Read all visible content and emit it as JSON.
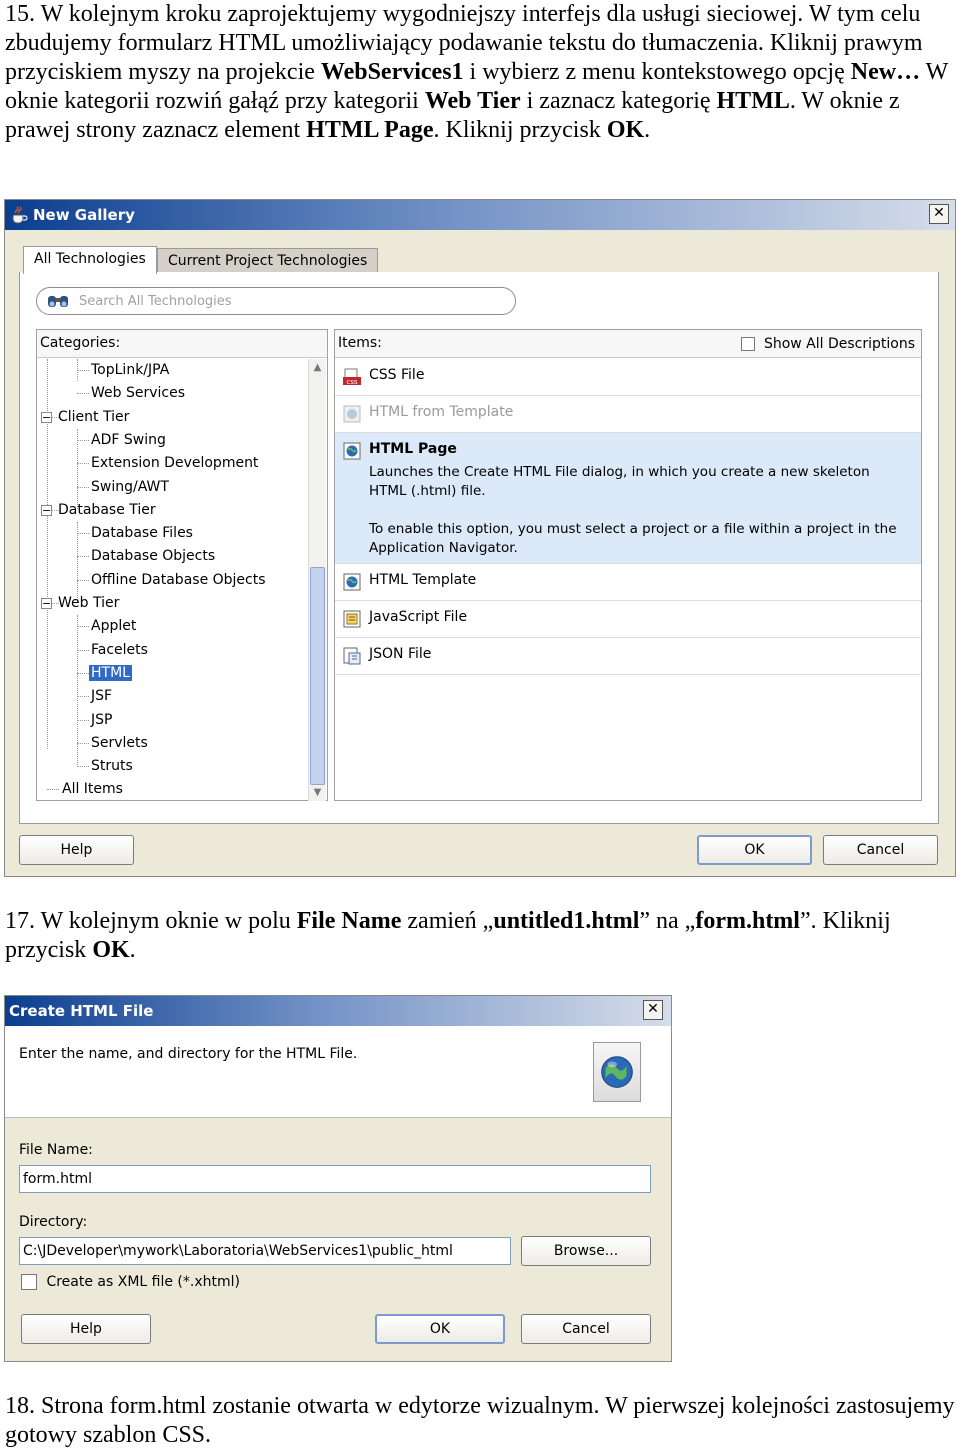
{
  "instructions": {
    "step15": {
      "t1": "15. W kolejnym kroku zaprojektujemy wygodniejszy interfejs dla usługi sieciowej. W tym celu zbudujemy formularz HTML umożliwiający podawanie tekstu do tłumaczenia. Kliknij prawym przyciskiem myszy na projekcie ",
      "b1": "WebServices1",
      "t2": " i wybierz z menu kontekstowego opcję ",
      "b2": "New…",
      "t3": " W oknie kategorii rozwiń gałąź przy kategorii ",
      "b3": "Web Tier",
      "t4": " i zaznacz kategorię ",
      "b4": "HTML",
      "t5": ". W oknie z prawej strony zaznacz element ",
      "b5": "HTML Page",
      "t6": ". Kliknij przycisk ",
      "b6": "OK",
      "t7": "."
    },
    "step17": {
      "t1": "17. W kolejnym oknie w polu ",
      "b1": "File Name",
      "t2": " zamień „",
      "b2": "untitled1.html",
      "t3": "” na „",
      "b3": "form.html",
      "t4": "”. Kliknij przycisk ",
      "b4": "OK",
      "t5": "."
    },
    "step18": {
      "text": "18. Strona form.html zostanie otwarta w edytorze wizualnym. W pierwszej kolejności zastosujemy gotowy szablon CSS."
    }
  },
  "new_gallery": {
    "title": "New Gallery",
    "close": "✕",
    "tabs": [
      "All Technologies",
      "Current Project Technologies"
    ],
    "search_placeholder": "Search All Technologies",
    "categories_header": "Categories:",
    "categories": [
      {
        "label": "TopLink/JPA",
        "level": 2
      },
      {
        "label": "Web Services",
        "level": 2
      },
      {
        "label": "Client Tier",
        "level": 1,
        "toggle": "−"
      },
      {
        "label": "ADF Swing",
        "level": 2
      },
      {
        "label": "Extension Development",
        "level": 2
      },
      {
        "label": "Swing/AWT",
        "level": 2
      },
      {
        "label": "Database Tier",
        "level": 1,
        "toggle": "−"
      },
      {
        "label": "Database Files",
        "level": 2
      },
      {
        "label": "Database Objects",
        "level": 2
      },
      {
        "label": "Offline Database Objects",
        "level": 2
      },
      {
        "label": "Web Tier",
        "level": 1,
        "toggle": "−"
      },
      {
        "label": "Applet",
        "level": 2
      },
      {
        "label": "Facelets",
        "level": 2
      },
      {
        "label": "HTML",
        "level": 2,
        "selected": true
      },
      {
        "label": "JSF",
        "level": 2
      },
      {
        "label": "JSP",
        "level": 2
      },
      {
        "label": "Servlets",
        "level": 2
      },
      {
        "label": "Struts",
        "level": 2
      },
      {
        "label": "All Items",
        "level": 1
      }
    ],
    "items_header": "Items:",
    "show_all_descriptions": "Show All Descriptions",
    "items": [
      {
        "label": "CSS File",
        "icon": "css-file-icon"
      },
      {
        "label": "HTML from Template",
        "icon": "html-template-icon",
        "disabled": true
      },
      {
        "label": "HTML Page",
        "icon": "html-page-icon",
        "selected": true,
        "desc1": "Launches the Create HTML File dialog, in which you create a new skeleton HTML (.html) file.",
        "desc2": "To enable this option, you must select a project or a file within a project in the Application Navigator."
      },
      {
        "label": "HTML Template",
        "icon": "html-template-icon"
      },
      {
        "label": "JavaScript File",
        "icon": "javascript-file-icon"
      },
      {
        "label": "JSON File",
        "icon": "json-file-icon"
      }
    ],
    "buttons": {
      "help": "Help",
      "ok": "OK",
      "cancel": "Cancel"
    }
  },
  "create_html": {
    "title": "Create HTML File",
    "close": "✕",
    "description": "Enter the name, and directory for the HTML File.",
    "file_name_label": "File Name:",
    "file_name_value": "form.html",
    "directory_label": "Directory:",
    "directory_value": "C:\\JDeveloper\\mywork\\Laboratoria\\WebServices1\\public_html",
    "browse": "Browse...",
    "xml_checkbox": "Create as XML file (*.xhtml)",
    "buttons": {
      "help": "Help",
      "ok": "OK",
      "cancel": "Cancel"
    }
  }
}
